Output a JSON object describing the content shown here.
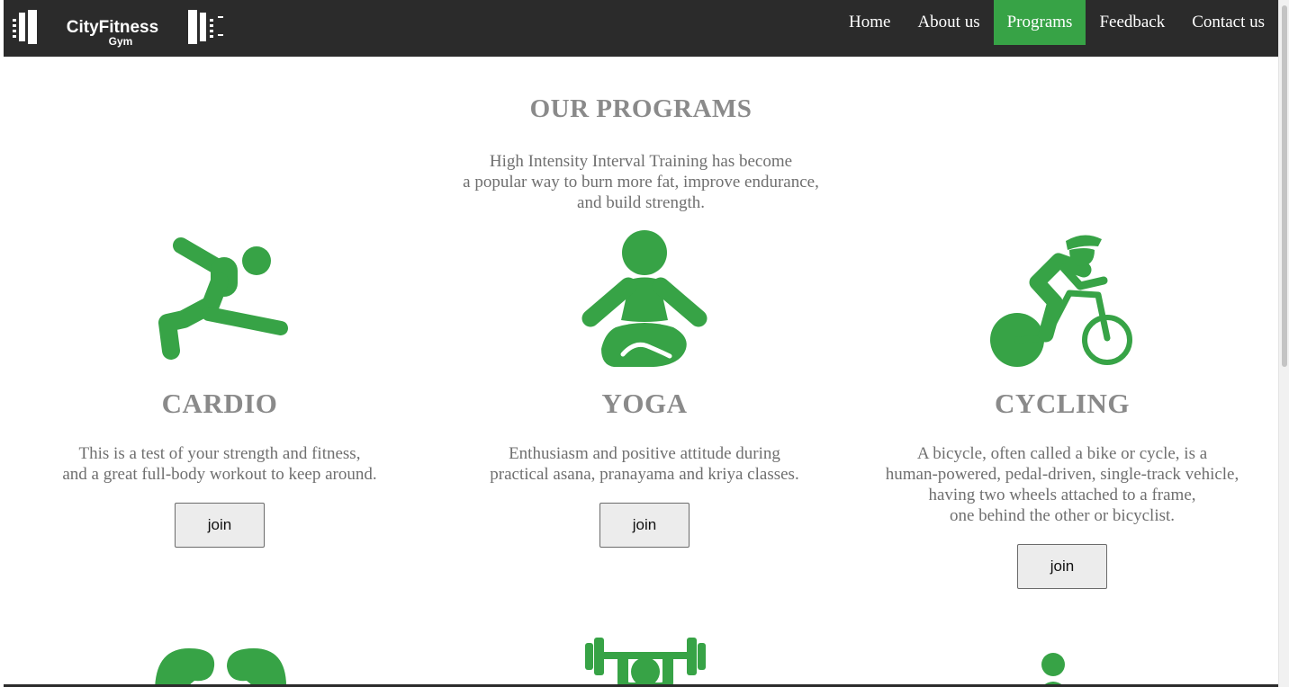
{
  "brand": {
    "logo_name": "CityFitness",
    "logo_sub": "Gym"
  },
  "nav": {
    "items": [
      {
        "label": "Home"
      },
      {
        "label": "About us"
      },
      {
        "label": "Programs",
        "active": true
      },
      {
        "label": "Feedback"
      },
      {
        "label": "Contact us"
      }
    ]
  },
  "colors": {
    "accent": "#37a346",
    "navbar_bg": "#2b2b2b",
    "heading": "#8a8a8a",
    "body_text": "#6f6f6f"
  },
  "section": {
    "title": "OUR PROGRAMS",
    "intro": [
      "High Intensity Interval Training has become",
      "a popular way to burn more fat, improve endurance,",
      "and build strength."
    ]
  },
  "programs": [
    {
      "icon": "cardio-lunge-icon",
      "title": "CARDIO",
      "desc": [
        "This is a test of your strength and fitness,",
        "and a great full-body workout to keep around."
      ],
      "button": "join"
    },
    {
      "icon": "yoga-meditation-icon",
      "title": "YOGA",
      "desc": [
        "Enthusiasm and positive attitude during",
        "practical asana, pranayama and kriya classes."
      ],
      "button": "join"
    },
    {
      "icon": "cycling-icon",
      "title": "CYCLING",
      "desc": [
        "A bicycle, often called a bike or cycle, is a",
        "human-powered, pedal-driven, single-track vehicle,",
        "having two wheels attached to a frame,",
        "one behind the other or bicyclist."
      ],
      "button": "join"
    }
  ],
  "next_row_icons": [
    "kidney-lungs-icon",
    "weightlifting-icon",
    "person-icon"
  ]
}
